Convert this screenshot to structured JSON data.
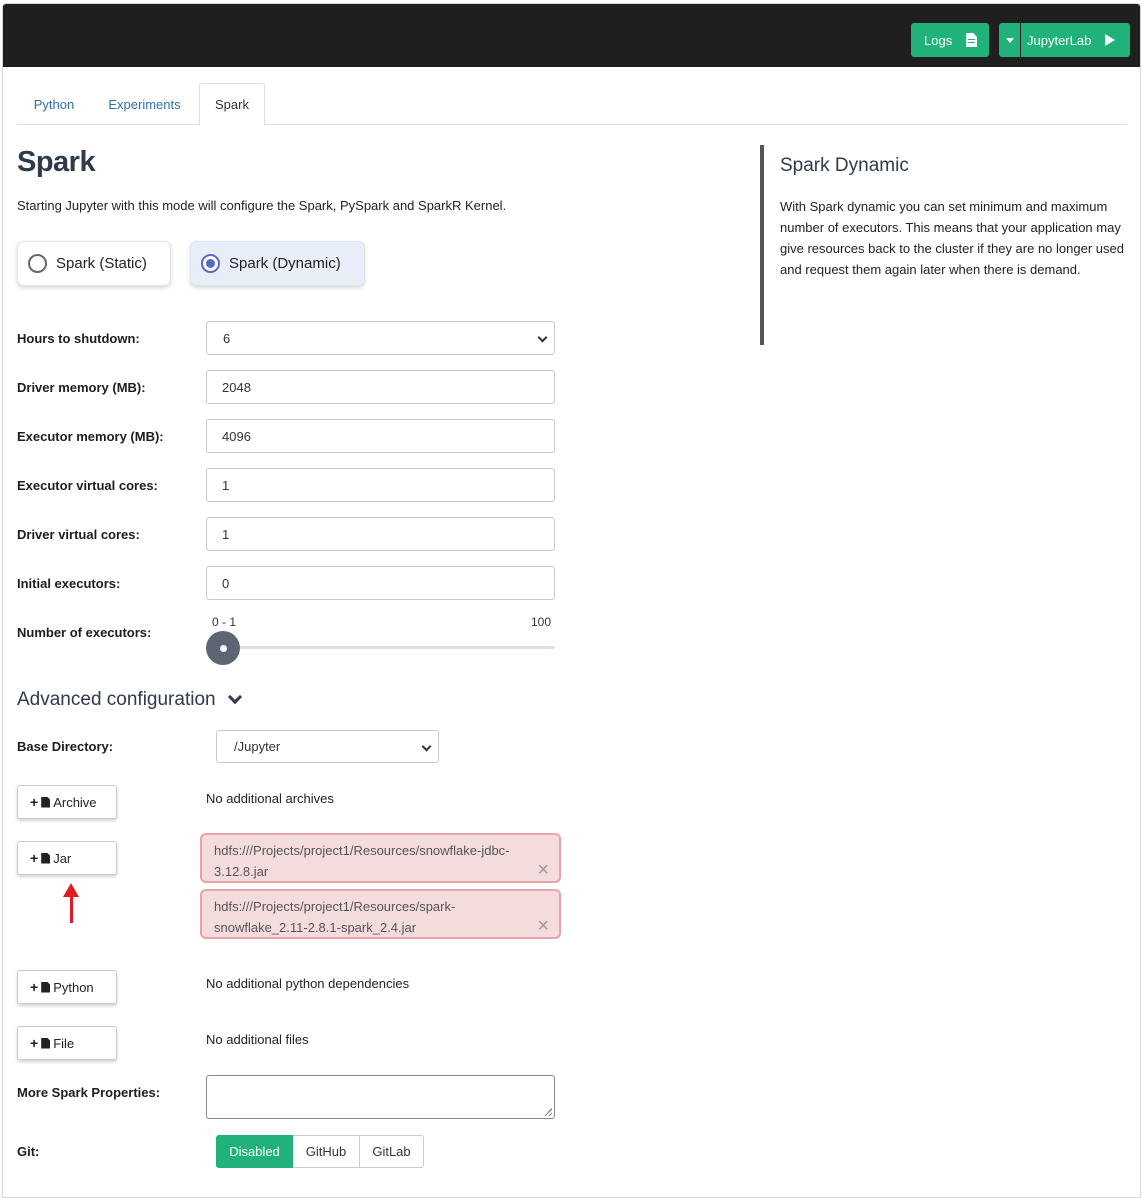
{
  "header": {
    "logs_label": "Logs",
    "jupyterlab_label": "JupyterLab"
  },
  "tabs": [
    {
      "label": "Python"
    },
    {
      "label": "Experiments"
    },
    {
      "label": "Spark"
    }
  ],
  "active_tab": "Spark",
  "page": {
    "title": "Spark",
    "subtitle": "Starting Jupyter with this mode will configure the Spark, PySpark and SparkR Kernel."
  },
  "modes": {
    "static_label": "Spark (Static)",
    "dynamic_label": "Spark (Dynamic)",
    "selected": "Spark (Dynamic)"
  },
  "form": {
    "hours": {
      "label": "Hours to shutdown:",
      "value": "6"
    },
    "driver_memory": {
      "label": "Driver memory (MB):",
      "value": "2048"
    },
    "executor_memory": {
      "label": "Executor memory (MB):",
      "value": "4096"
    },
    "executor_cores": {
      "label": "Executor virtual cores:",
      "value": "1"
    },
    "driver_cores": {
      "label": "Driver virtual cores:",
      "value": "1"
    },
    "initial_executors": {
      "label": "Initial executors:",
      "value": "0"
    },
    "num_executors": {
      "label": "Number of executors:",
      "range_label": "0 - 1",
      "max_label": "100",
      "min": 0,
      "max": 100
    }
  },
  "advanced": {
    "title": "Advanced configuration",
    "base_dir_label": "Base Directory:",
    "base_dir_value": "/Jupyter",
    "archive_btn": "Archive",
    "archive_note": "No additional archives",
    "jar_btn": "Jar",
    "jars": [
      {
        "path": "hdfs:///Projects/project1/Resources/snowflake-jdbc-3.12.8.jar"
      },
      {
        "path": "hdfs:///Projects/project1/Resources/spark-snowflake_2.11-2.8.1-spark_2.4.jar"
      }
    ],
    "python_btn": "Python",
    "python_note": "No additional python dependencies",
    "file_btn": "File",
    "file_note": "No additional files",
    "more_props_label": "More Spark Properties:",
    "git_label": "Git:",
    "git_options": [
      "Disabled",
      "GitHub",
      "GitLab"
    ],
    "git_selected": "Disabled"
  },
  "sidebar": {
    "title": "Spark Dynamic",
    "text": "With Spark dynamic you can set minimum and maximum number of executors. This means that your application may give resources back to the cluster if they are no longer used and request them again later when there is demand."
  },
  "colors": {
    "accent": "#21b17b",
    "header_bg": "#1f1f1f",
    "radio_selected": "#5c6bc0",
    "jar_bg": "#f4dcdd",
    "annotation_arrow": "#e01b24"
  }
}
